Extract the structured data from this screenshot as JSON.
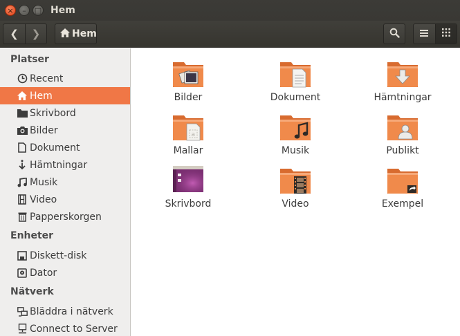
{
  "window": {
    "title": "Hem",
    "close_glyph": "×",
    "minimize_glyph": "–",
    "maximize_glyph": "□"
  },
  "toolbar": {
    "back_glyph": "❮",
    "forward_glyph": "❯",
    "path_label": "Hem",
    "icons": [
      "back-icon",
      "forward-icon",
      "home-icon",
      "search-icon",
      "list-view-icon",
      "grid-view-icon"
    ]
  },
  "sidebar": {
    "sections": [
      {
        "title": "Platser"
      },
      {
        "title": "Enheter"
      },
      {
        "title": "Nätverk"
      }
    ],
    "items": [
      {
        "label": "Recent",
        "icon": "clock-icon"
      },
      {
        "label": "Hem",
        "icon": "home-icon",
        "active": true
      },
      {
        "label": "Skrivbord",
        "icon": "desktop-folder-icon"
      },
      {
        "label": "Bilder",
        "icon": "camera-icon"
      },
      {
        "label": "Dokument",
        "icon": "document-icon"
      },
      {
        "label": "Hämtningar",
        "icon": "download-icon"
      },
      {
        "label": "Musik",
        "icon": "music-icon"
      },
      {
        "label": "Video",
        "icon": "film-icon"
      },
      {
        "label": "Papperskorgen",
        "icon": "trash-icon"
      },
      {
        "label": "Diskett-disk",
        "icon": "floppy-icon"
      },
      {
        "label": "Dator",
        "icon": "harddisk-icon"
      },
      {
        "label": "Bläddra i nätverk",
        "icon": "network-icon"
      },
      {
        "label": "Connect to Server",
        "icon": "server-icon"
      }
    ],
    "active_color": "#f07746"
  },
  "files": [
    {
      "label": "Bilder",
      "icon": "pictures-folder-icon"
    },
    {
      "label": "Dokument",
      "icon": "documents-folder-icon"
    },
    {
      "label": "Hämtningar",
      "icon": "downloads-folder-icon"
    },
    {
      "label": "Mallar",
      "icon": "templates-folder-icon"
    },
    {
      "label": "Musik",
      "icon": "music-folder-icon"
    },
    {
      "label": "Publikt",
      "icon": "public-folder-icon"
    },
    {
      "label": "Skrivbord",
      "icon": "desktop-folder-icon"
    },
    {
      "label": "Video",
      "icon": "videos-folder-icon"
    },
    {
      "label": "Exempel",
      "icon": "link-folder-icon"
    }
  ],
  "colors": {
    "folder_orange": "#f08a4b",
    "desktop_purple": "#7c2f73",
    "titlebar": "#3c3b37"
  }
}
